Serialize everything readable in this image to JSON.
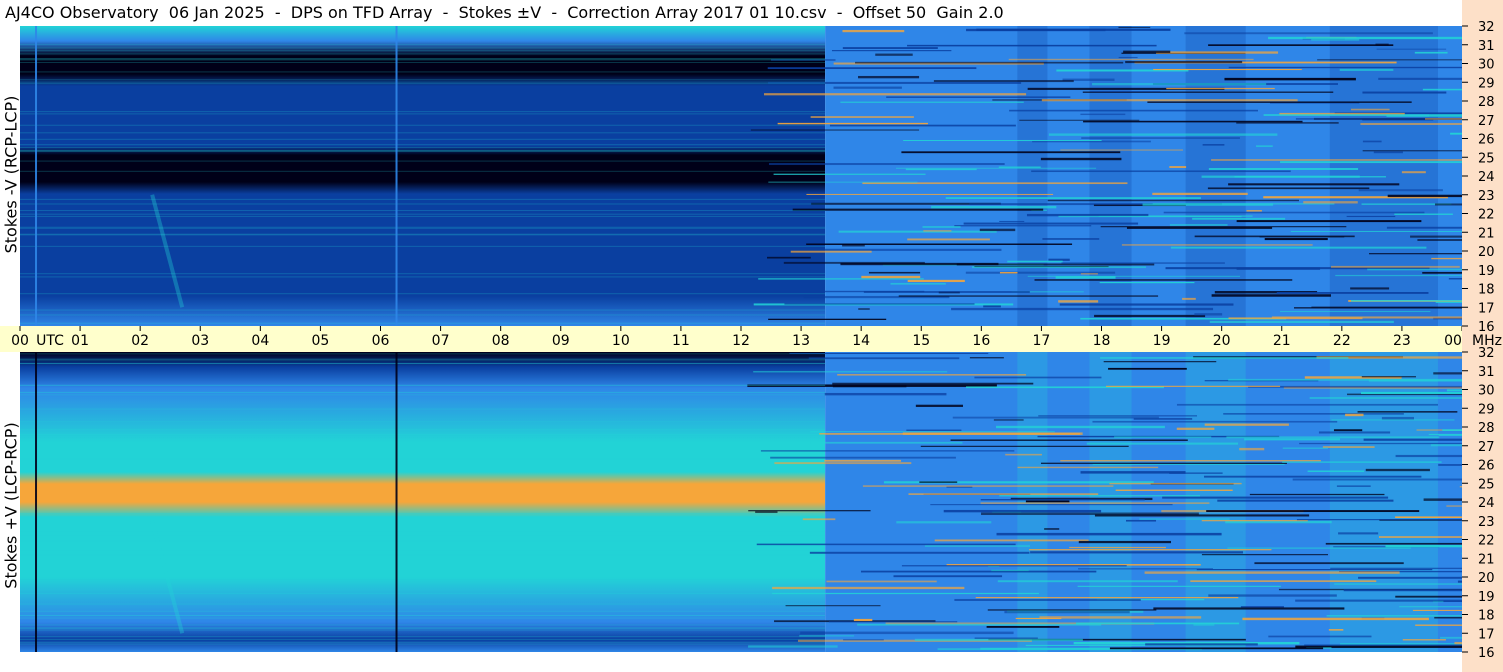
{
  "header": {
    "title": "AJ4CO Observatory  06 Jan 2025  -  DPS on TFD Array  -  Stokes ±V  -  Correction Array 2017 01 10.csv  -  Offset 50  Gain 2.0"
  },
  "chart_data": [
    {
      "type": "heatmap",
      "ylabel": "Stokes -V (RCP-LCP)",
      "xlabel": "UTC",
      "y_unit": "MHz",
      "xlim": [
        0,
        24
      ],
      "ylim": [
        16,
        32
      ],
      "x_ticks": [
        "00",
        "01",
        "02",
        "03",
        "04",
        "05",
        "06",
        "07",
        "08",
        "09",
        "10",
        "11",
        "12",
        "13",
        "14",
        "15",
        "16",
        "17",
        "18",
        "19",
        "20",
        "21",
        "22",
        "23",
        "00"
      ],
      "y_ticks": [
        "32",
        "31",
        "30",
        "29",
        "28",
        "27",
        "26",
        "25",
        "24",
        "23",
        "22",
        "21",
        "20",
        "19",
        "18",
        "17",
        "16"
      ],
      "colors": {
        "dark": "#000018",
        "low": "#0a3fa0",
        "mid": "#2f86e8",
        "high": "#22d3d6",
        "peak": "#f6a63a"
      }
    },
    {
      "type": "heatmap",
      "ylabel": "Stokes +V (LCP-RCP)",
      "xlabel": "UTC",
      "y_unit": "MHz",
      "xlim": [
        0,
        24
      ],
      "ylim": [
        16,
        32
      ],
      "x_ticks": [
        "00",
        "01",
        "02",
        "03",
        "04",
        "05",
        "06",
        "07",
        "08",
        "09",
        "10",
        "11",
        "12",
        "13",
        "14",
        "15",
        "16",
        "17",
        "18",
        "19",
        "20",
        "21",
        "22",
        "23",
        "00"
      ],
      "y_ticks": [
        "32",
        "31",
        "30",
        "29",
        "28",
        "27",
        "26",
        "25",
        "24",
        "23",
        "22",
        "21",
        "20",
        "19",
        "18",
        "17",
        "16"
      ],
      "colors": {
        "dark": "#000018",
        "low": "#0a3fa0",
        "mid": "#2f86e8",
        "high": "#22d3d6",
        "peak": "#f6a63a"
      }
    }
  ],
  "axis": {
    "utc_label": "UTC",
    "mhz_label": "MHz"
  }
}
